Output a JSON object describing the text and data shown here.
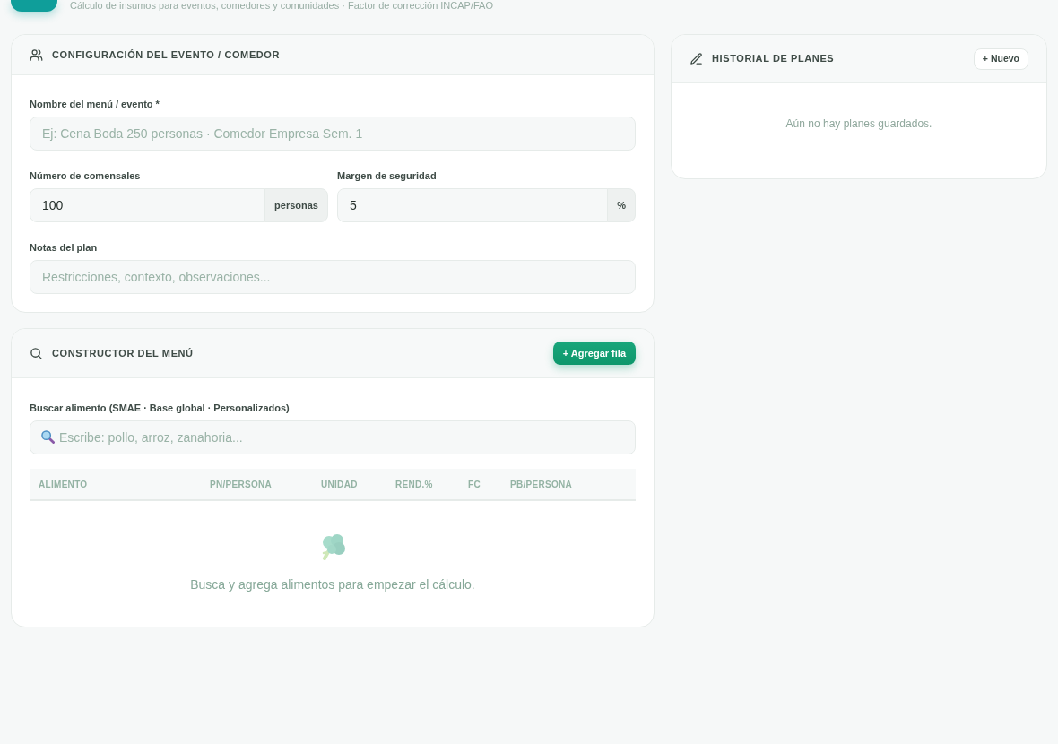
{
  "header": {
    "subtitle": "Cálculo de insumos para eventos, comedores y comunidades · Factor de corrección INCAP/FAO"
  },
  "config_card": {
    "title": "CONFIGURACIÓN DEL EVENTO / COMEDOR",
    "fields": [
      {
        "kind": "text",
        "label": "Nombre del menú / evento *",
        "placeholder": "Ej: Cena Boda 250 personas · Comedor Empresa Sem. 1"
      },
      {
        "kind": "addon",
        "label": "Número de comensales",
        "value": "100",
        "addon": "personas"
      },
      {
        "kind": "addon",
        "label": "Margen de seguridad",
        "value": "5",
        "addon": "%"
      },
      {
        "kind": "text",
        "label": "Notas del plan",
        "placeholder": "Restricciones, contexto, observaciones..."
      }
    ]
  },
  "menu_builder": {
    "title": "CONSTRUCTOR DEL MENÚ",
    "add_button": "+ Agregar fila",
    "search": {
      "label": "Buscar alimento (SMAE · Base global · Personalizados)",
      "placeholder": "Escribe: pollo, arroz, zanahoria..."
    },
    "table": {
      "columns": [
        "ALIMENTO",
        "PN/PERSONA",
        "UNIDAD",
        "REND.%",
        "FC",
        "PB/PERSONA"
      ]
    },
    "empty_message": "Busca y agrega alimentos para empezar el cálculo."
  },
  "history_card": {
    "title": "HISTORIAL DE PLANES",
    "new_button": "+ Nuevo",
    "empty_message": "Aún no hay planes guardados."
  }
}
